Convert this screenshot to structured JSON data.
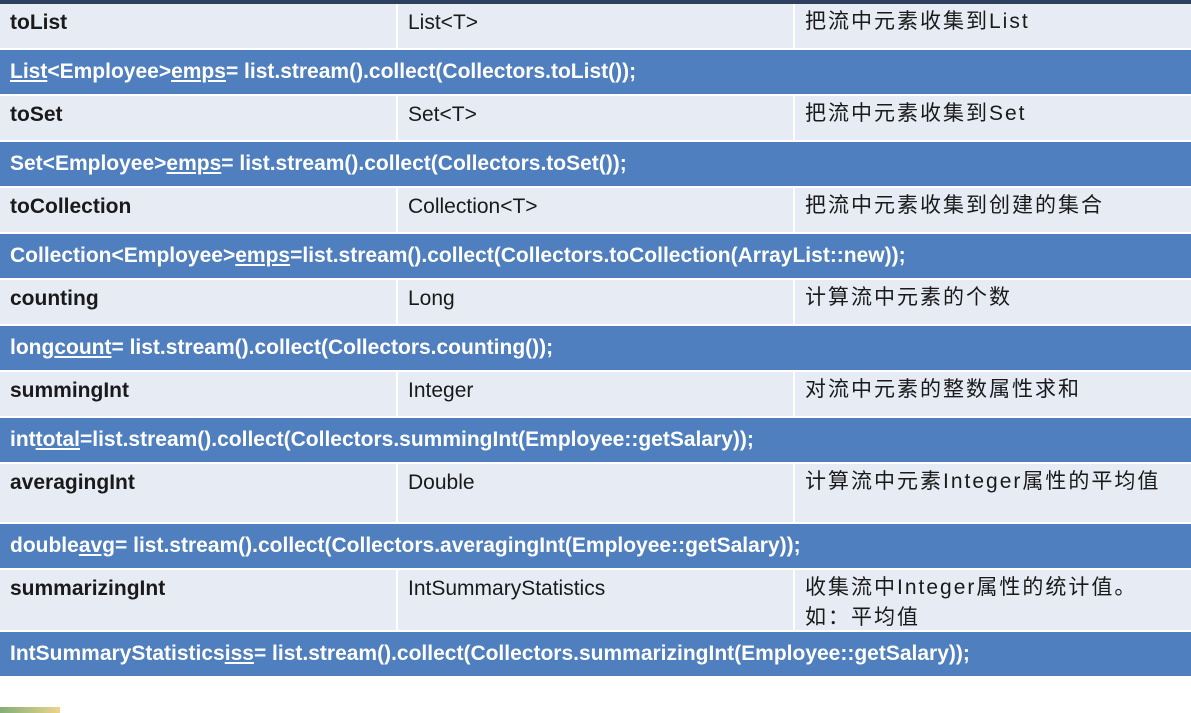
{
  "rows": [
    {
      "method": "toList",
      "type": "List<T>",
      "desc": "把流中元素收集到List",
      "code": [
        {
          "text": "List",
          "u": true
        },
        {
          "text": "<Employee> ",
          "u": false
        },
        {
          "text": "emps",
          "u": true
        },
        {
          "text": "= list.stream().collect(Collectors.toList());",
          "u": false
        }
      ]
    },
    {
      "method": "toSet",
      "type": "Set<T>",
      "desc": "把流中元素收集到Set",
      "code": [
        {
          "text": "Set<Employee> ",
          "u": false
        },
        {
          "text": "emps",
          "u": true
        },
        {
          "text": "= list.stream().collect(Collectors.toSet());",
          "u": false
        }
      ]
    },
    {
      "method": "toCollection",
      "type": "Collection<T>",
      "desc": "把流中元素收集到创建的集合",
      "code": [
        {
          "text": "Collection<Employee>",
          "u": false
        },
        {
          "text": "emps",
          "u": true
        },
        {
          "text": "=list.stream().collect(Collectors.toCollection(ArrayList::new));",
          "u": false
        }
      ]
    },
    {
      "method": "counting",
      "type": "Long",
      "desc": "计算流中元素的个数",
      "code": [
        {
          "text": "long ",
          "u": false
        },
        {
          "text": "count",
          "u": true
        },
        {
          "text": " = list.stream().collect(Collectors.counting());",
          "u": false
        }
      ]
    },
    {
      "method": "summingInt",
      "type": "Integer",
      "desc": "对流中元素的整数属性求和",
      "code": [
        {
          "text": "int",
          "u": false
        },
        {
          "text": "total",
          "u": true
        },
        {
          "text": "=list.stream().collect(Collectors.summingInt(Employee::getSalary));",
          "u": false
        }
      ]
    },
    {
      "method": "averagingInt",
      "type": "Double",
      "desc": "计算流中元素Integer属性的平均值",
      "code": [
        {
          "text": "double",
          "u": false
        },
        {
          "text": "avg",
          "u": true
        },
        {
          "text": "= list.stream().collect(Collectors.averagingInt(Employee::getSalary));",
          "u": false
        }
      ]
    },
    {
      "method": "summarizingInt",
      "type": "IntSummaryStatistics",
      "desc": "收集流中Integer属性的统计值。如：平均值",
      "code": [
        {
          "text": "IntSummaryStatistics",
          "u": false
        },
        {
          "text": "iss",
          "u": true
        },
        {
          "text": "= list.stream().collect(Collectors.summarizingInt(Employee::getSalary));",
          "u": false
        }
      ]
    }
  ]
}
